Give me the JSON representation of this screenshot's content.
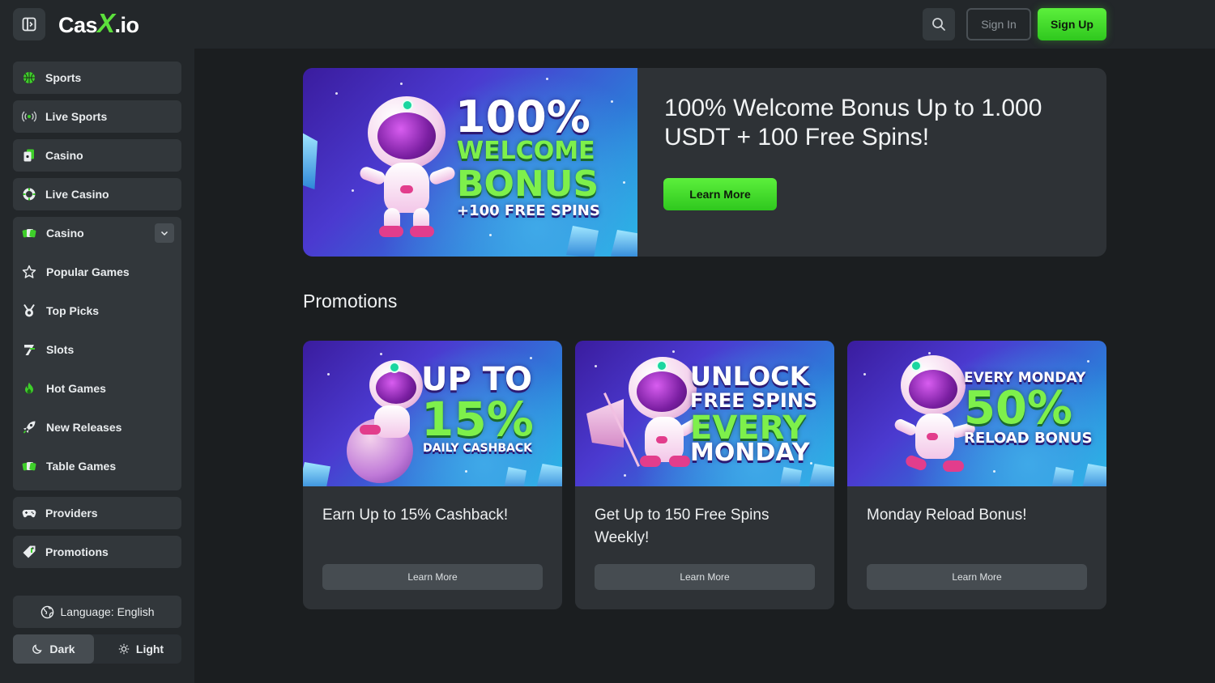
{
  "header": {
    "logo_text": "Cas",
    "logo_x": "X",
    "logo_suffix": ".io",
    "sign_in_label": "Sign In",
    "sign_up_label": "Sign Up"
  },
  "sidebar": {
    "items": [
      {
        "label": "Sports",
        "icon": "basketball-icon"
      },
      {
        "label": "Live Sports",
        "icon": "broadcast-icon"
      },
      {
        "label": "Casino",
        "icon": "cards-icon"
      },
      {
        "label": "Live Casino",
        "icon": "poker-chip-icon"
      }
    ],
    "casino_group": {
      "label": "Casino",
      "icon": "casino-cards-icon",
      "children": [
        {
          "label": "Popular Games",
          "icon": "star-icon"
        },
        {
          "label": "Top Picks",
          "icon": "medal-icon"
        },
        {
          "label": "Slots",
          "icon": "seven-icon"
        },
        {
          "label": "Hot Games",
          "icon": "flame-icon"
        },
        {
          "label": "New Releases",
          "icon": "rocket-icon"
        },
        {
          "label": "Table Games",
          "icon": "table-cards-icon"
        }
      ]
    },
    "bottom_items": [
      {
        "label": "Providers",
        "icon": "gamepad-icon"
      },
      {
        "label": "Promotions",
        "icon": "tag-icon"
      }
    ],
    "language_label": "Language: English",
    "theme": {
      "dark_label": "Dark",
      "light_label": "Light",
      "selected": "Dark"
    }
  },
  "hero": {
    "title": "100% Welcome Bonus Up to 1.000 USDT + 100 Free Spins!",
    "button_label": "Learn More",
    "art_lines": [
      "100%",
      "WELCOME",
      "BONUS",
      "+100 FREE SPINS"
    ]
  },
  "promotions": {
    "section_title": "Promotions",
    "cards": [
      {
        "title": "Earn Up to 15% Cashback!",
        "button_label": "Learn More",
        "art_lines": [
          "UP TO",
          "15%",
          "DAILY CASHBACK"
        ]
      },
      {
        "title": "Get Up to 150 Free Spins Weekly!",
        "button_label": "Learn More",
        "art_lines": [
          "UNLOCK",
          "FREE SPINS",
          "EVERY",
          "MONDAY"
        ]
      },
      {
        "title": "Monday Reload Bonus!",
        "button_label": "Learn More",
        "art_lines": [
          "EVERY MONDAY",
          "50%",
          "RELOAD BONUS"
        ]
      }
    ]
  },
  "colors": {
    "accent_green": "#4ee533",
    "page_bg": "#1b1e20",
    "panel_bg": "#23272a",
    "card_bg": "#2e3236"
  }
}
